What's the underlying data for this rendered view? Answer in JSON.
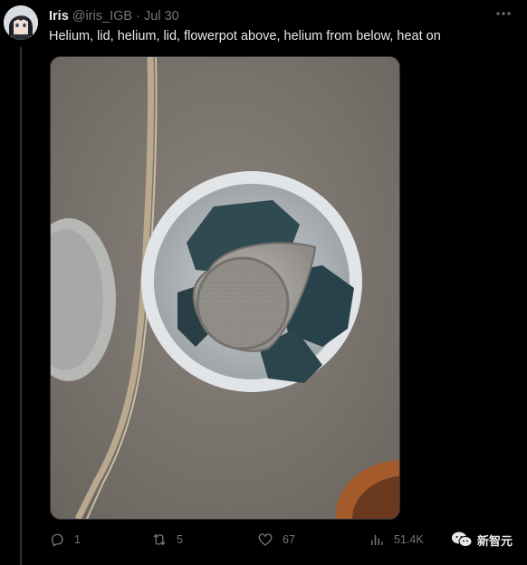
{
  "tweet": {
    "author_name": "Iris",
    "handle": "@iris_IGB",
    "separator": "·",
    "date": "Jul 30",
    "text": "Helium, lid, helium, lid, flowerpot above, helium from below, heat on"
  },
  "actions": {
    "replies": "1",
    "retweets": "5",
    "likes": "67",
    "views": "51.4K"
  },
  "icons": {
    "more": "more-icon",
    "reply": "reply-icon",
    "retweet": "retweet-icon",
    "like": "heart-icon",
    "views": "views-icon"
  },
  "watermark": {
    "text": "新智元"
  },
  "colors": {
    "background": "#000000",
    "primary_text": "#e7e9ea",
    "secondary_text": "#71767b",
    "divider": "#2f3336"
  }
}
